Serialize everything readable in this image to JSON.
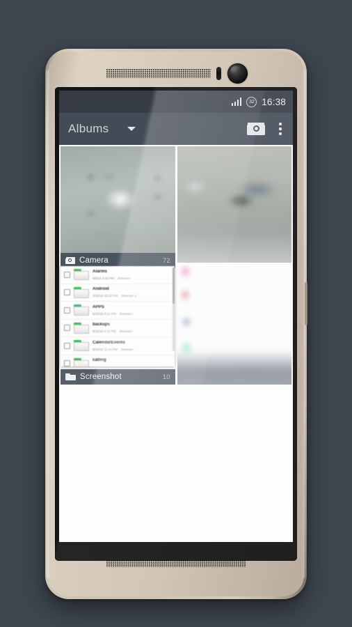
{
  "device": {
    "name": "android-smartphone-mockup",
    "frame_color": "#d2c6b6",
    "bezel_color": "#151515",
    "page_background": "#3e4650"
  },
  "status_bar": {
    "signal_icon": "cellular-signal-icon",
    "battery_icon": "battery-circle-icon",
    "battery_level": "32",
    "clock": "16:38",
    "background": "#353c46"
  },
  "action_bar": {
    "title": "Albums",
    "dropdown_icon": "chevron-down-icon",
    "camera_icon": "camera-icon",
    "overflow_icon": "overflow-menu-icon",
    "background": "#434b57"
  },
  "albums": [
    {
      "name": "Camera",
      "count": "72",
      "icon": "camera-icon"
    },
    {
      "name": "Screenshot",
      "count": "10",
      "icon": "folder-icon"
    }
  ],
  "file_overlay": {
    "scrollbar_icon": "scrollbar-thumb",
    "rows": [
      {
        "name": "Alarms",
        "date": "6/8/15 4:40 PM",
        "permissions": "drwxrwx--",
        "checkbox": "unchecked",
        "icon": "folder-icon"
      },
      {
        "name": "Android",
        "date": "2/15/16 10:12 PM",
        "permissions": "drwxrwx--x",
        "checkbox": "unchecked",
        "icon": "folder-icon"
      },
      {
        "name": "APPS",
        "date": "6/23/16 3:14 PM",
        "permissions": "drwxrwx--",
        "checkbox": "unchecked",
        "icon": "folder-icon"
      },
      {
        "name": "backups",
        "date": "5/13/16 5:15 PM",
        "permissions": "drwxrwx--",
        "checkbox": "unchecked",
        "icon": "folder-icon"
      },
      {
        "name": "CalendarEvents",
        "date": "6/24/16 11:44 PM",
        "permissions": "drwxrwx--",
        "checkbox": "unchecked",
        "icon": "folder-icon"
      },
      {
        "name": "calling",
        "date": "",
        "permissions": "",
        "checkbox": "unchecked",
        "icon": "folder-icon"
      }
    ]
  }
}
